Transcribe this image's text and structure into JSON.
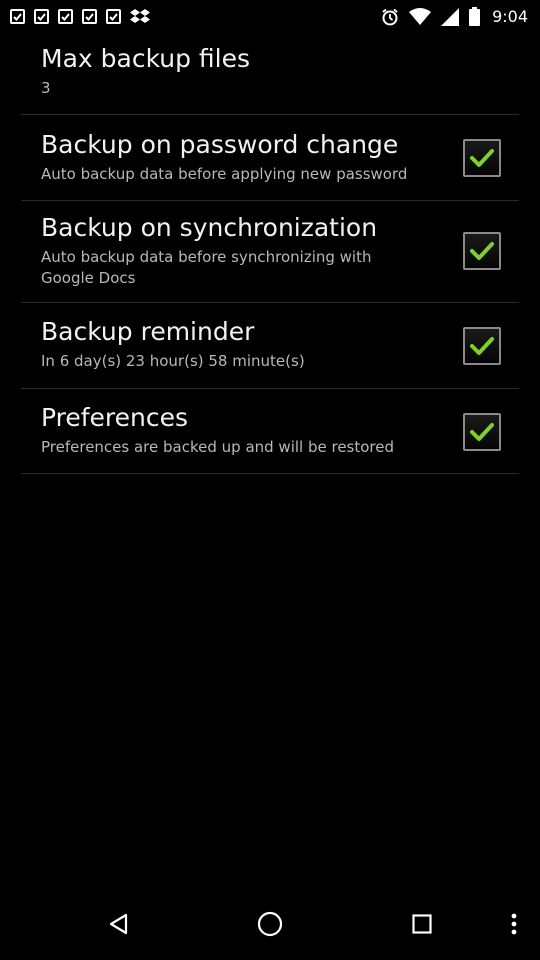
{
  "status_bar": {
    "time": "9:04",
    "icons": [
      "notification-icon",
      "notification-icon",
      "notification-icon",
      "notification-icon",
      "notification-icon",
      "dropbox-icon",
      "alarm-icon",
      "wifi-icon",
      "signal-icon",
      "battery-icon"
    ]
  },
  "settings": {
    "max_backup": {
      "title": "Max backup files",
      "summary": "3"
    },
    "items": [
      {
        "title": "Backup on password change",
        "summary": "Auto backup data before applying new password",
        "checked": true
      },
      {
        "title": "Backup on synchronization",
        "summary": "Auto backup data before synchronizing with Google Docs",
        "checked": true
      },
      {
        "title": "Backup reminder",
        "summary": "In 6 day(s) 23 hour(s) 58 minute(s)",
        "checked": true
      },
      {
        "title": "Preferences",
        "summary": "Preferences are backed up and will be restored",
        "checked": true
      }
    ]
  },
  "nav_bar": {
    "buttons": [
      "back-icon",
      "home-icon",
      "recents-icon",
      "more-options-icon"
    ]
  },
  "colors": {
    "background": "#000000",
    "check": "#7fd02a",
    "divider": "#2a2a2a"
  }
}
